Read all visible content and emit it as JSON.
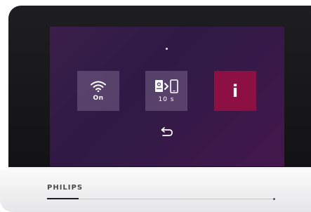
{
  "device": {
    "brand": "PHILIPS"
  },
  "screen": {
    "tiles": [
      {
        "name": "wifi",
        "icon": "wifi-icon",
        "label": "On"
      },
      {
        "name": "ring-timeout",
        "icon": "doorbell-to-phone-icon",
        "label": "10 s"
      },
      {
        "name": "info",
        "icon": "info-icon",
        "label": "i"
      }
    ],
    "back_icon": "return-arrow-icon"
  },
  "colors": {
    "screen_background": "#3a1f4a",
    "tile_background": "#6b5a7a",
    "info_tile_background": "#8c1042",
    "text": "#ffffff"
  }
}
